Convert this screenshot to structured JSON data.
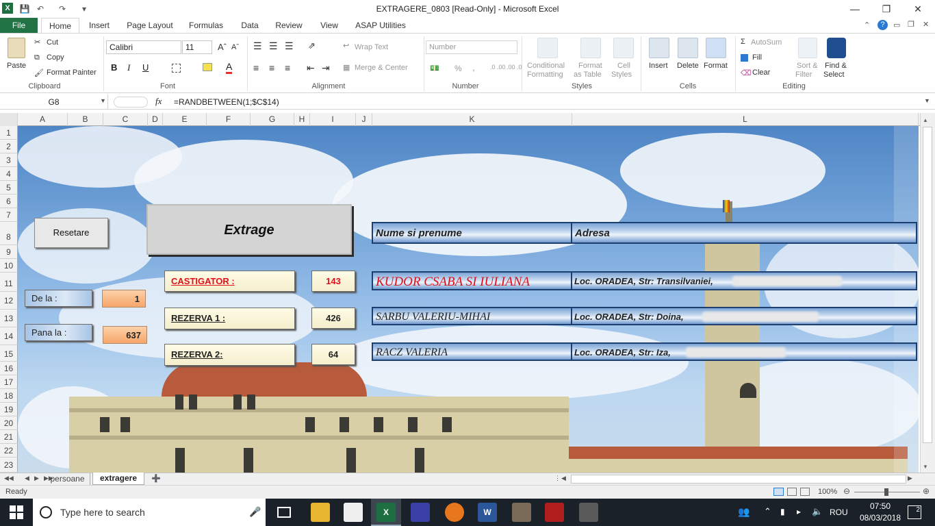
{
  "window": {
    "title": "EXTRAGERE_0803  [Read-Only]  -  Microsoft Excel",
    "app_icon": "X"
  },
  "ribbon_tabs": [
    "File",
    "Home",
    "Insert",
    "Page Layout",
    "Formulas",
    "Data",
    "Review",
    "View",
    "ASAP Utilities"
  ],
  "clipboard": {
    "paste": "Paste",
    "cut": "Cut",
    "copy": "Copy",
    "format_painter": "Format Painter",
    "label": "Clipboard"
  },
  "font": {
    "name": "Calibri",
    "size": "11",
    "bold": "B",
    "italic": "I",
    "underline": "U",
    "label": "Font"
  },
  "alignment": {
    "wrap_text": "Wrap Text",
    "merge_center": "Merge & Center",
    "label": "Alignment"
  },
  "number": {
    "format": "Number",
    "percent": "%",
    "comma": ",",
    "inc_dec": ".0 .00",
    "dec_dec": ".00 .0",
    "label": "Number"
  },
  "styles": {
    "conditional": "Conditional",
    "conditional2": "Formatting",
    "format_table": "Format",
    "format_table2": "as Table",
    "cell_styles": "Cell",
    "cell_styles2": "Styles",
    "label": "Styles"
  },
  "cells": {
    "insert": "Insert",
    "delete": "Delete",
    "format": "Format",
    "label": "Cells"
  },
  "editing": {
    "autosum": "AutoSum",
    "fill": "Fill",
    "clear": "Clear",
    "sort": "Sort &",
    "sort2": "Filter",
    "find": "Find &",
    "find2": "Select",
    "label": "Editing"
  },
  "formula_bar": {
    "name_box": "G8",
    "fx": "fx",
    "formula": "=RANDBETWEEN(1;$C$14)"
  },
  "columns": [
    "A",
    "B",
    "C",
    "D",
    "E",
    "F",
    "G",
    "H",
    "I",
    "J",
    "K",
    "L"
  ],
  "rows": [
    "1",
    "2",
    "3",
    "4",
    "5",
    "6",
    "7",
    "8",
    "9",
    "10",
    "11",
    "12",
    "13",
    "14",
    "15",
    "16",
    "17",
    "18",
    "19",
    "20",
    "21",
    "22",
    "23"
  ],
  "controls": {
    "reset": "Resetare",
    "draw": "Extrage",
    "from_label": "De la :",
    "from_value": "1",
    "to_label": "Pana la :",
    "to_value": "637",
    "winner_label": "CASTIGATOR :",
    "winner_value": "143",
    "reserve1_label": "REZERVA 1 :",
    "reserve1_value": "426",
    "reserve2_label": "REZERVA 2:",
    "reserve2_value": "64"
  },
  "results_table": {
    "header_name": "Nume si prenume",
    "header_address": "Adresa",
    "rows": [
      {
        "name": "KUDOR CSABA SI IULIANA",
        "address": "Loc. ORADEA, Str: Transilvaniei,"
      },
      {
        "name": "SARBU VALERIU-MIHAI",
        "address": "Loc. ORADEA, Str: Doina,"
      },
      {
        "name": "RACZ VALERIA",
        "address": "Loc. ORADEA, Str: Iza,"
      }
    ]
  },
  "sheet_tabs": [
    "persoane",
    "extragere"
  ],
  "status": {
    "ready": "Ready",
    "zoom": "100%"
  },
  "taskbar": {
    "search_placeholder": "Type here to search",
    "language": "ROU",
    "time": "07:50",
    "date": "08/03/2018",
    "notifications": "2"
  },
  "colors": {
    "excel_green": "#217346",
    "winner_red": "#e0101a",
    "taskbar": "#1b2129"
  }
}
